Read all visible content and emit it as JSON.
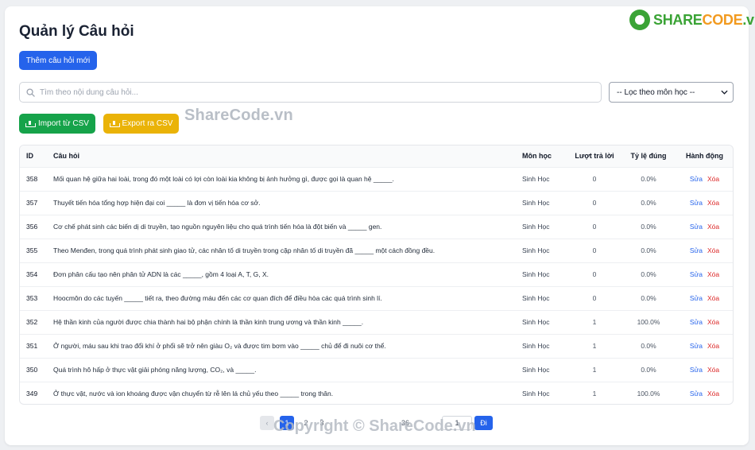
{
  "logo": {
    "part_a": "SHARE",
    "part_b": "CODE",
    "suffix": ".vn"
  },
  "page": {
    "title": "Quản lý Câu hỏi"
  },
  "toolbar": {
    "add_label": "Thêm câu hỏi mới",
    "import_label": "Import từ CSV",
    "export_label": "Export ra CSV"
  },
  "search": {
    "placeholder": "Tìm theo nội dung câu hỏi...",
    "value": ""
  },
  "filter": {
    "selected": "-- Lọc theo môn học --"
  },
  "watermarks": {
    "top": "ShareCode.vn",
    "bottom": "Copyright © ShareCode.vn"
  },
  "table": {
    "headers": {
      "id": "ID",
      "question": "Câu hỏi",
      "subject": "Môn học",
      "answers": "Lượt trả lời",
      "rate": "Tỷ lệ đúng",
      "actions": "Hành động"
    },
    "edit_label": "Sửa",
    "delete_label": "Xóa",
    "rows": [
      {
        "id": "358",
        "question": "Mối quan hệ giữa hai loài, trong đó một loài có lợi còn loài kia không bị ảnh hưởng gì, được gọi là quan hệ _____.",
        "subject": "Sinh Học",
        "answers": "0",
        "rate": "0.0%"
      },
      {
        "id": "357",
        "question": "Thuyết tiến hóa tổng hợp hiện đại coi _____ là đơn vị tiến hóa cơ sở.",
        "subject": "Sinh Học",
        "answers": "0",
        "rate": "0.0%"
      },
      {
        "id": "356",
        "question": "Cơ chế phát sinh các biến dị di truyền, tạo nguồn nguyên liệu cho quá trình tiến hóa là đột biến và _____ gen.",
        "subject": "Sinh Học",
        "answers": "0",
        "rate": "0.0%"
      },
      {
        "id": "355",
        "question": "Theo Menđen, trong quá trình phát sinh giao tử, các nhân tố di truyền trong cặp nhân tố di truyền đã _____ một cách đồng đều.",
        "subject": "Sinh Học",
        "answers": "0",
        "rate": "0.0%"
      },
      {
        "id": "354",
        "question": "Đơn phân cấu tạo nên phân tử ADN là các _____, gồm 4 loại A, T, G, X.",
        "subject": "Sinh Học",
        "answers": "0",
        "rate": "0.0%"
      },
      {
        "id": "353",
        "question": "Hoocmôn do các tuyến _____ tiết ra, theo đường máu đến các cơ quan đích để điều hòa các quá trình sinh lí.",
        "subject": "Sinh Học",
        "answers": "0",
        "rate": "0.0%"
      },
      {
        "id": "352",
        "question": "Hệ thần kinh của người được chia thành hai bộ phận chính là thần kinh trung ương và thần kinh _____.",
        "subject": "Sinh Học",
        "answers": "1",
        "rate": "100.0%"
      },
      {
        "id": "351",
        "question": "Ở người, máu sau khi trao đổi khí ở phổi sẽ trở nên giàu O₂ và được tim bơm vào _____ chủ để đi nuôi cơ thể.",
        "subject": "Sinh Học",
        "answers": "1",
        "rate": "0.0%"
      },
      {
        "id": "350",
        "question": "Quá trình hô hấp ở thực vật giải phóng năng lượng, CO₂, và _____.",
        "subject": "Sinh Học",
        "answers": "1",
        "rate": "0.0%"
      },
      {
        "id": "349",
        "question": "Ở thực vật, nước và ion khoáng được vận chuyển từ rễ lên lá chủ yếu theo _____ trong thân.",
        "subject": "Sinh Học",
        "answers": "1",
        "rate": "100.0%"
      }
    ]
  },
  "pagination": {
    "prev": "‹",
    "current": "1",
    "p2": "2",
    "p3": "3",
    "last": "36",
    "input_value": "1",
    "go_label": "Đi"
  }
}
